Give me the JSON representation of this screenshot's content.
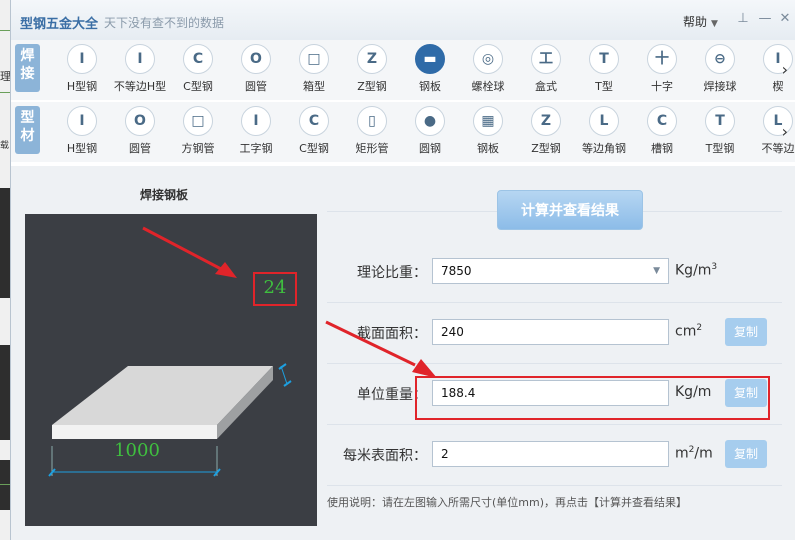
{
  "background_desktop": {
    "text_1": "理",
    "text_2": "载"
  },
  "window": {
    "title": "型钢五金大全",
    "slogan": "天下没有查不到的数据",
    "help_label": "帮助",
    "controls": [
      "pin-icon",
      "minimize-icon",
      "close-icon"
    ]
  },
  "toolbar_welded": {
    "category": [
      "焊",
      "接"
    ],
    "items": [
      {
        "label": "H型钢",
        "icon": "I"
      },
      {
        "label": "不等边H型",
        "icon": "I"
      },
      {
        "label": "C型钢",
        "icon": "C"
      },
      {
        "label": "圆管",
        "icon": "O"
      },
      {
        "label": "箱型",
        "icon": "□"
      },
      {
        "label": "Z型钢",
        "icon": "Z"
      },
      {
        "label": "钢板",
        "icon": "▬"
      },
      {
        "label": "螺栓球",
        "icon": "◎"
      },
      {
        "label": "盒式",
        "icon": "工"
      },
      {
        "label": "T型",
        "icon": "T"
      },
      {
        "label": "十字",
        "icon": "十"
      },
      {
        "label": "焊接球",
        "icon": "⊖"
      },
      {
        "label": "楔",
        "icon": "I"
      }
    ],
    "selected": "钢板"
  },
  "toolbar_profile": {
    "category": [
      "型",
      "材"
    ],
    "items": [
      {
        "label": "H型钢",
        "icon": "I"
      },
      {
        "label": "圆管",
        "icon": "O"
      },
      {
        "label": "方钢管",
        "icon": "□"
      },
      {
        "label": "工字钢",
        "icon": "I"
      },
      {
        "label": "C型钢",
        "icon": "C"
      },
      {
        "label": "矩形管",
        "icon": "▯"
      },
      {
        "label": "圆钢",
        "icon": "●"
      },
      {
        "label": "钢板",
        "icon": "▦"
      },
      {
        "label": "Z型钢",
        "icon": "Z"
      },
      {
        "label": "等边角钢",
        "icon": "L"
      },
      {
        "label": "槽钢",
        "icon": "C"
      },
      {
        "label": "T型钢",
        "icon": "T"
      },
      {
        "label": "不等边",
        "icon": "L"
      }
    ]
  },
  "drawing": {
    "title": "焊接钢板",
    "thickness": "24",
    "width": "1000"
  },
  "calc": {
    "button_label": "计算并查看结果",
    "density_label": "理论比重：",
    "density_value": "7850",
    "density_unit": "Kg/m",
    "density_unit_sup": "3",
    "area_label": "截面面积：",
    "area_value": "240",
    "area_unit": "cm",
    "area_unit_sup": "2",
    "weight_label": "单位重量：",
    "weight_value": "188.4",
    "weight_unit": "Kg/m",
    "surface_label": "每米表面积：",
    "surface_value": "2",
    "surface_unit_pre": "m",
    "surface_unit_sup": "2",
    "surface_unit_post": "/m",
    "copy_label": "复制",
    "hint": "使用说明：请在左图输入所需尺寸(单位mm)，再点击【计算并查看结果】"
  },
  "colors": {
    "accent": "#2f6ba8",
    "highlight_red": "#e0242a",
    "dimension_green": "#3fbf3f",
    "panel_bg": "#3b3e44"
  }
}
